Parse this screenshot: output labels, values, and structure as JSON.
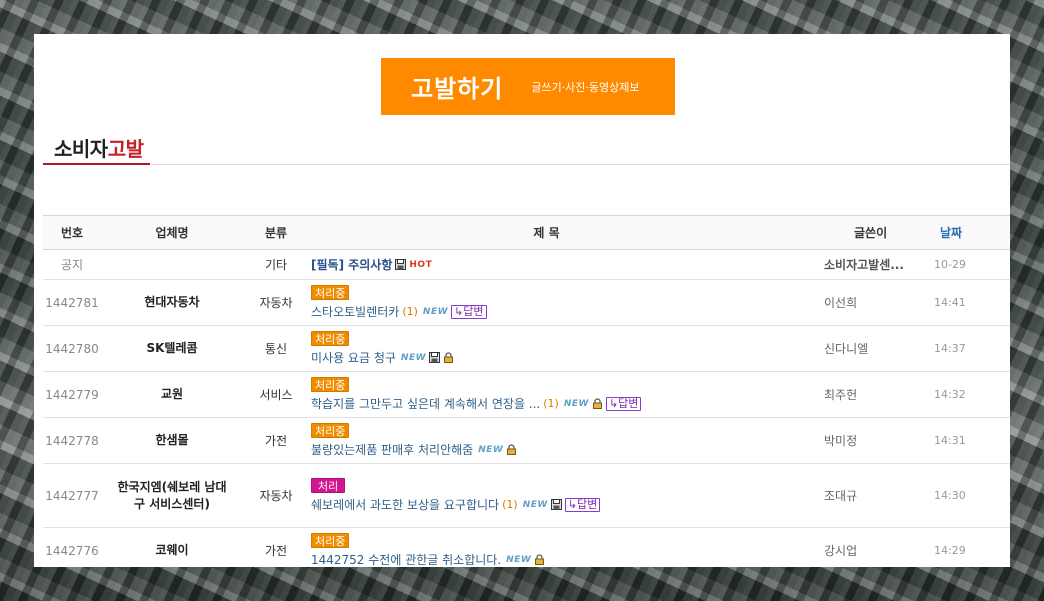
{
  "banner": {
    "title": "고발하기",
    "subtitle": "글쓰기·사진·동영상제보"
  },
  "section": {
    "title_main": "소비자",
    "title_accent": "고발"
  },
  "table": {
    "headers": {
      "no": "번호",
      "company": "업체명",
      "category": "분류",
      "subject": "제 목",
      "writer": "글쓴이",
      "date": "날짜"
    },
    "notice": {
      "no": "공지",
      "company": "",
      "category": "기타",
      "subject": "[필독] 주의사항",
      "hot": "HOT",
      "writer": "소비자고발센...",
      "date": "10-29"
    },
    "rows": [
      {
        "no": "1442781",
        "company": "현대자동차",
        "category": "자동차",
        "status": "처리중",
        "subject": "스타오토빌렌터카",
        "count": "(1)",
        "new": "NEW",
        "reply": "↳답변",
        "writer": "이선희",
        "date": "14:41"
      },
      {
        "no": "1442780",
        "company": "SK텔레콤",
        "category": "통신",
        "status": "처리중",
        "subject": "미사용 요금 청구",
        "count": "",
        "new": "NEW",
        "reply": "",
        "writer": "신다니엘",
        "date": "14:37"
      },
      {
        "no": "1442779",
        "company": "교원",
        "category": "서비스",
        "status": "처리중",
        "subject": "학습지를 그만두고 싶은데 계속해서 연장을 ...",
        "count": "(1)",
        "new": "NEW",
        "reply": "↳답변",
        "writer": "최주헌",
        "date": "14:32"
      },
      {
        "no": "1442778",
        "company": "한샘몰",
        "category": "가전",
        "status": "처리중",
        "subject": "불량있는제품 판매후 처리안해줌",
        "count": "",
        "new": "NEW",
        "reply": "",
        "writer": "박미정",
        "date": "14:31"
      },
      {
        "no": "1442777",
        "company": "한국지엠(쉐보레 남대구 서비스센터)",
        "category": "자동차",
        "status": "처리",
        "subject": "쉐보레에서 과도한 보상을 요구합니다",
        "count": "(1)",
        "new": "NEW",
        "reply": "↳답변",
        "writer": "조대규",
        "date": "14:30"
      },
      {
        "no": "1442776",
        "company": "코웨이",
        "category": "가전",
        "status": "처리중",
        "subject": "1442752 수전에 관한글 취소합니다.",
        "count": "",
        "new": "NEW",
        "reply": "",
        "writer": "강시업",
        "date": "14:29"
      }
    ]
  },
  "colors": {
    "banner_bg": "#ff8a00",
    "accent_red": "#c7202a",
    "status_processing": "#f08c00",
    "status_done": "#d3158f"
  }
}
